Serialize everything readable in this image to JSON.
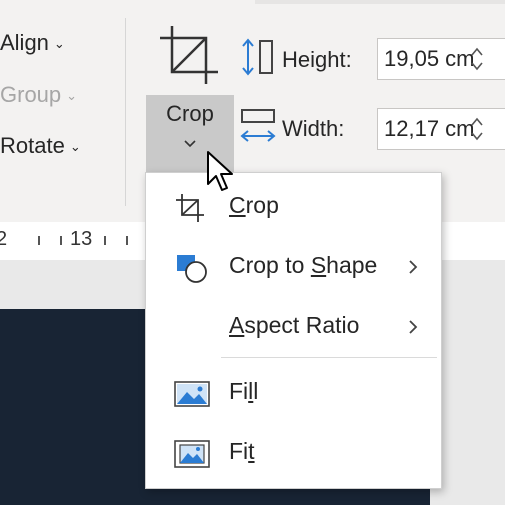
{
  "arrange": {
    "align": "Align",
    "group": "Group",
    "rotate": "Rotate"
  },
  "crop_button": {
    "label": "Crop"
  },
  "size": {
    "height_label": "Height:",
    "height_value": "19,05 cm",
    "width_label": "Width:",
    "width_value": "12,17 cm"
  },
  "ruler": {
    "marks": [
      "2",
      "13"
    ]
  },
  "crop_menu": {
    "items": [
      {
        "pre": "",
        "key": "C",
        "post": "rop",
        "icon": "crop-icon"
      },
      {
        "pre": "Crop to ",
        "key": "S",
        "post": "hape",
        "icon": "crop-to-shape-icon",
        "submenu": true
      },
      {
        "pre": "",
        "key": "A",
        "post": "spect Ratio",
        "icon": "",
        "submenu": true
      },
      {
        "pre": "Fi",
        "key": "l",
        "post": "l",
        "icon": "fill-icon"
      },
      {
        "pre": "Fi",
        "key": "t",
        "post": "",
        "icon": "fit-icon"
      }
    ]
  },
  "colors": {
    "ribbon_bg": "#f3f2f1",
    "accent_blue": "#2b7cd3",
    "pressed_button": "#c9c9c9",
    "slide_bg": "#182434"
  }
}
